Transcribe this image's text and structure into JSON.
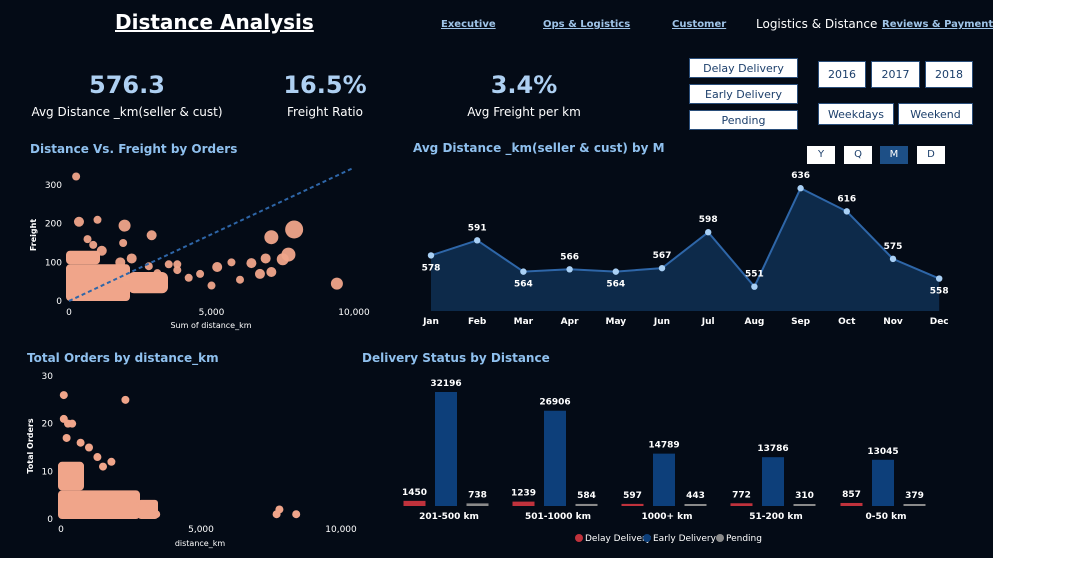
{
  "header": {
    "title": "Distance Analysis",
    "nav": [
      "Executive",
      "Ops & Logistics",
      "Customer",
      "Logistics & Distance",
      "Reviews & Payment"
    ],
    "active_nav": "Logistics & Distance"
  },
  "kpis": [
    {
      "value": "576.3",
      "label": "Avg Distance _km(seller & cust)"
    },
    {
      "value": "16.5%",
      "label": "Freight Ratio"
    },
    {
      "value": "3.4%",
      "label": "Avg Freight per km"
    }
  ],
  "slicers": {
    "status": [
      "Delay Delivery",
      "Early Delivery",
      "Pending"
    ],
    "years": [
      "2016",
      "2017",
      "2018"
    ],
    "days": [
      "Weekdays",
      "Weekend"
    ],
    "periods": [
      "Y",
      "Q",
      "M",
      "D"
    ],
    "active_period": "M"
  },
  "colors": {
    "background": "#040b16",
    "accent": "#8fc0ee",
    "scatter": "#f0a58a",
    "delay": "#c0323c",
    "early": "#0d3f7a",
    "pending": "#8a8a8a",
    "area": "#0d2a4a",
    "line": "#2e66a8"
  },
  "chart_data": [
    {
      "type": "scatter",
      "title": "Distance Vs. Freight by Orders",
      "xlabel": "Sum of distance_km",
      "ylabel": "Freight",
      "xlim": [
        0,
        10000
      ],
      "ylim": [
        0,
        340
      ],
      "xticks": [
        "0",
        "5,000",
        "10,000"
      ],
      "yticks": [
        "0",
        "100",
        "200",
        "300"
      ],
      "trendline": {
        "x": [
          0,
          10000
        ],
        "y": [
          0,
          345
        ]
      },
      "points": [
        {
          "x": 1800,
          "y": 100,
          "r": 5
        },
        {
          "x": 2000,
          "y": 60,
          "r": 4
        },
        {
          "x": 2200,
          "y": 110,
          "r": 5
        },
        {
          "x": 1900,
          "y": 150,
          "r": 4
        },
        {
          "x": 2800,
          "y": 90,
          "r": 4
        },
        {
          "x": 3100,
          "y": 72,
          "r": 4
        },
        {
          "x": 3500,
          "y": 95,
          "r": 4
        },
        {
          "x": 3800,
          "y": 80,
          "r": 4
        },
        {
          "x": 4200,
          "y": 60,
          "r": 4
        },
        {
          "x": 4600,
          "y": 70,
          "r": 4
        },
        {
          "x": 5000,
          "y": 40,
          "r": 4
        },
        {
          "x": 5200,
          "y": 88,
          "r": 5
        },
        {
          "x": 5700,
          "y": 100,
          "r": 4
        },
        {
          "x": 6000,
          "y": 55,
          "r": 4
        },
        {
          "x": 6400,
          "y": 98,
          "r": 5
        },
        {
          "x": 6700,
          "y": 70,
          "r": 5
        },
        {
          "x": 6900,
          "y": 110,
          "r": 5
        },
        {
          "x": 7100,
          "y": 75,
          "r": 5
        },
        {
          "x": 7500,
          "y": 108,
          "r": 6
        },
        {
          "x": 7700,
          "y": 120,
          "r": 7
        },
        {
          "x": 7100,
          "y": 165,
          "r": 7
        },
        {
          "x": 7900,
          "y": 185,
          "r": 9
        },
        {
          "x": 9400,
          "y": 45,
          "r": 6
        },
        {
          "x": 250,
          "y": 322,
          "r": 4
        },
        {
          "x": 350,
          "y": 205,
          "r": 5
        },
        {
          "x": 650,
          "y": 160,
          "r": 4
        },
        {
          "x": 1000,
          "y": 210,
          "r": 4
        },
        {
          "x": 1950,
          "y": 195,
          "r": 6
        },
        {
          "x": 2900,
          "y": 170,
          "r": 5
        },
        {
          "x": 850,
          "y": 145,
          "r": 4
        },
        {
          "x": 1150,
          "y": 130,
          "r": 5
        },
        {
          "x": 3800,
          "y": 95,
          "r": 4
        }
      ]
    },
    {
      "type": "area",
      "title": "Avg Distance _km(seller & cust) by M",
      "categories": [
        "Jan",
        "Feb",
        "Mar",
        "Apr",
        "May",
        "Jun",
        "Jul",
        "Aug",
        "Sep",
        "Oct",
        "Nov",
        "Dec"
      ],
      "values": [
        578,
        591,
        564,
        566,
        564,
        567,
        598,
        551,
        636,
        616,
        575,
        558
      ],
      "ylim": [
        530,
        650
      ]
    },
    {
      "type": "scatter",
      "title": "Total Orders by distance_km",
      "xlabel": "distance_km",
      "ylabel": "Total Orders",
      "xlim": [
        0,
        10000
      ],
      "ylim": [
        0,
        30
      ],
      "xticks": [
        "0",
        "5,000",
        "10,000"
      ],
      "yticks": [
        "0",
        "10",
        "20",
        "30"
      ],
      "points": [
        {
          "x": 100,
          "y": 26
        },
        {
          "x": 2300,
          "y": 25
        },
        {
          "x": 100,
          "y": 21
        },
        {
          "x": 250,
          "y": 20
        },
        {
          "x": 400,
          "y": 20
        },
        {
          "x": 700,
          "y": 16
        },
        {
          "x": 1000,
          "y": 15
        },
        {
          "x": 200,
          "y": 17
        },
        {
          "x": 1300,
          "y": 13
        },
        {
          "x": 1800,
          "y": 12
        },
        {
          "x": 1500,
          "y": 11
        },
        {
          "x": 7800,
          "y": 2
        },
        {
          "x": 7700,
          "y": 1
        },
        {
          "x": 8400,
          "y": 1
        },
        {
          "x": 2600,
          "y": 4
        },
        {
          "x": 2900,
          "y": 3
        },
        {
          "x": 3200,
          "y": 2
        },
        {
          "x": 3400,
          "y": 1
        }
      ]
    },
    {
      "type": "bar",
      "title": "Delivery Status by Distance",
      "categories": [
        "201-500 km",
        "501-1000 km",
        "1000+ km",
        "51-200 km",
        "0-50 km"
      ],
      "series": [
        {
          "name": "Delay Delivery",
          "values": [
            1450,
            1239,
            597,
            772,
            857
          ]
        },
        {
          "name": "Early Delivery",
          "values": [
            32196,
            26906,
            14789,
            13786,
            13045
          ]
        },
        {
          "name": "Pending",
          "values": [
            738,
            584,
            443,
            310,
            379
          ]
        }
      ],
      "ylim": [
        0,
        34000
      ],
      "legend": "bottom"
    }
  ]
}
